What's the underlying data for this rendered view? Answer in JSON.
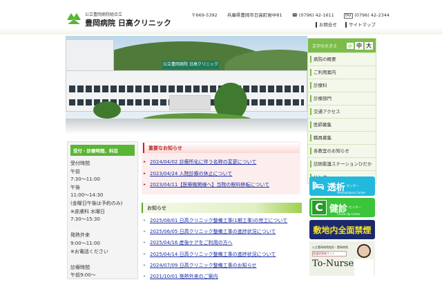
{
  "header": {
    "org_small": "公立豊岡病院組合立",
    "org_name": "豊岡病院 日高クリニック",
    "postal": "〒669-5392",
    "address": "兵庫県豊岡市日高町岩中81",
    "tel": "(0796) 42-1611",
    "fax_label": "FAX",
    "fax": "(0796) 42-2344",
    "links": [
      "お問合せ",
      "サイトマップ"
    ]
  },
  "hero": {
    "sign": "公立豊岡病院 日高クリニック"
  },
  "font_size": {
    "label": "文字の大きさ",
    "small": "小",
    "medium": "中",
    "large": "大"
  },
  "nav": [
    "病院の概要",
    "ご利用案内",
    "診療科",
    "診療部門",
    "交通アクセス",
    "医師募集",
    "職員募集",
    "各教室のお知らせ",
    "訪問看護ステーションひだか",
    "リンク"
  ],
  "hours": {
    "title": "受付・診療時間、科目",
    "lines": [
      "受付時間",
      "午前",
      "7:30～11:00",
      "午後",
      "11:00～14:30",
      "(金曜日午後は予約のみ)",
      "※皮膚科 水曜日",
      "7:30～15:30",
      "",
      "発熱外来",
      "9:00～11:00",
      "※お電話ください",
      "",
      "診療時間",
      "午前9:00～"
    ]
  },
  "important": {
    "title": "重要なお知らせ",
    "items": [
      "2024/04/02 診療所化に伴う名称の変更について",
      "2023/04/24 入院診療の休止について",
      "2023/04/11【医療機関様へ】当院の眼科移転について"
    ]
  },
  "news": {
    "title": "お知らせ",
    "items": [
      "2025/08/01 日高クリニック整備工事(1期工事)の完工について",
      "2025/06/05 日高クリニック整備工事の進捗状況について",
      "2025/04/16 産後ケアをご利用の方へ",
      "2025/04/14 日高クリニック整備工事の進捗状況について",
      "2024/07/09 日高クリニック整備工事のお知らせ",
      "2021/10/01 発熱外来のご案内"
    ]
  },
  "banners": {
    "dialysis": "透析",
    "dialysis_small": "センター",
    "dialysis_en": "Hemodialysis Center",
    "checkup": "健診",
    "checkup_small": "センター",
    "checkup_en": "Check-Up Center",
    "checkup_letter": "C",
    "nosmoking": "敷地内全面禁煙",
    "nurse_org": "公立豊岡病院組合・豊岡病院",
    "nurse_sub": "看護師募集サイト",
    "nurse_title": "To-Nurse"
  }
}
